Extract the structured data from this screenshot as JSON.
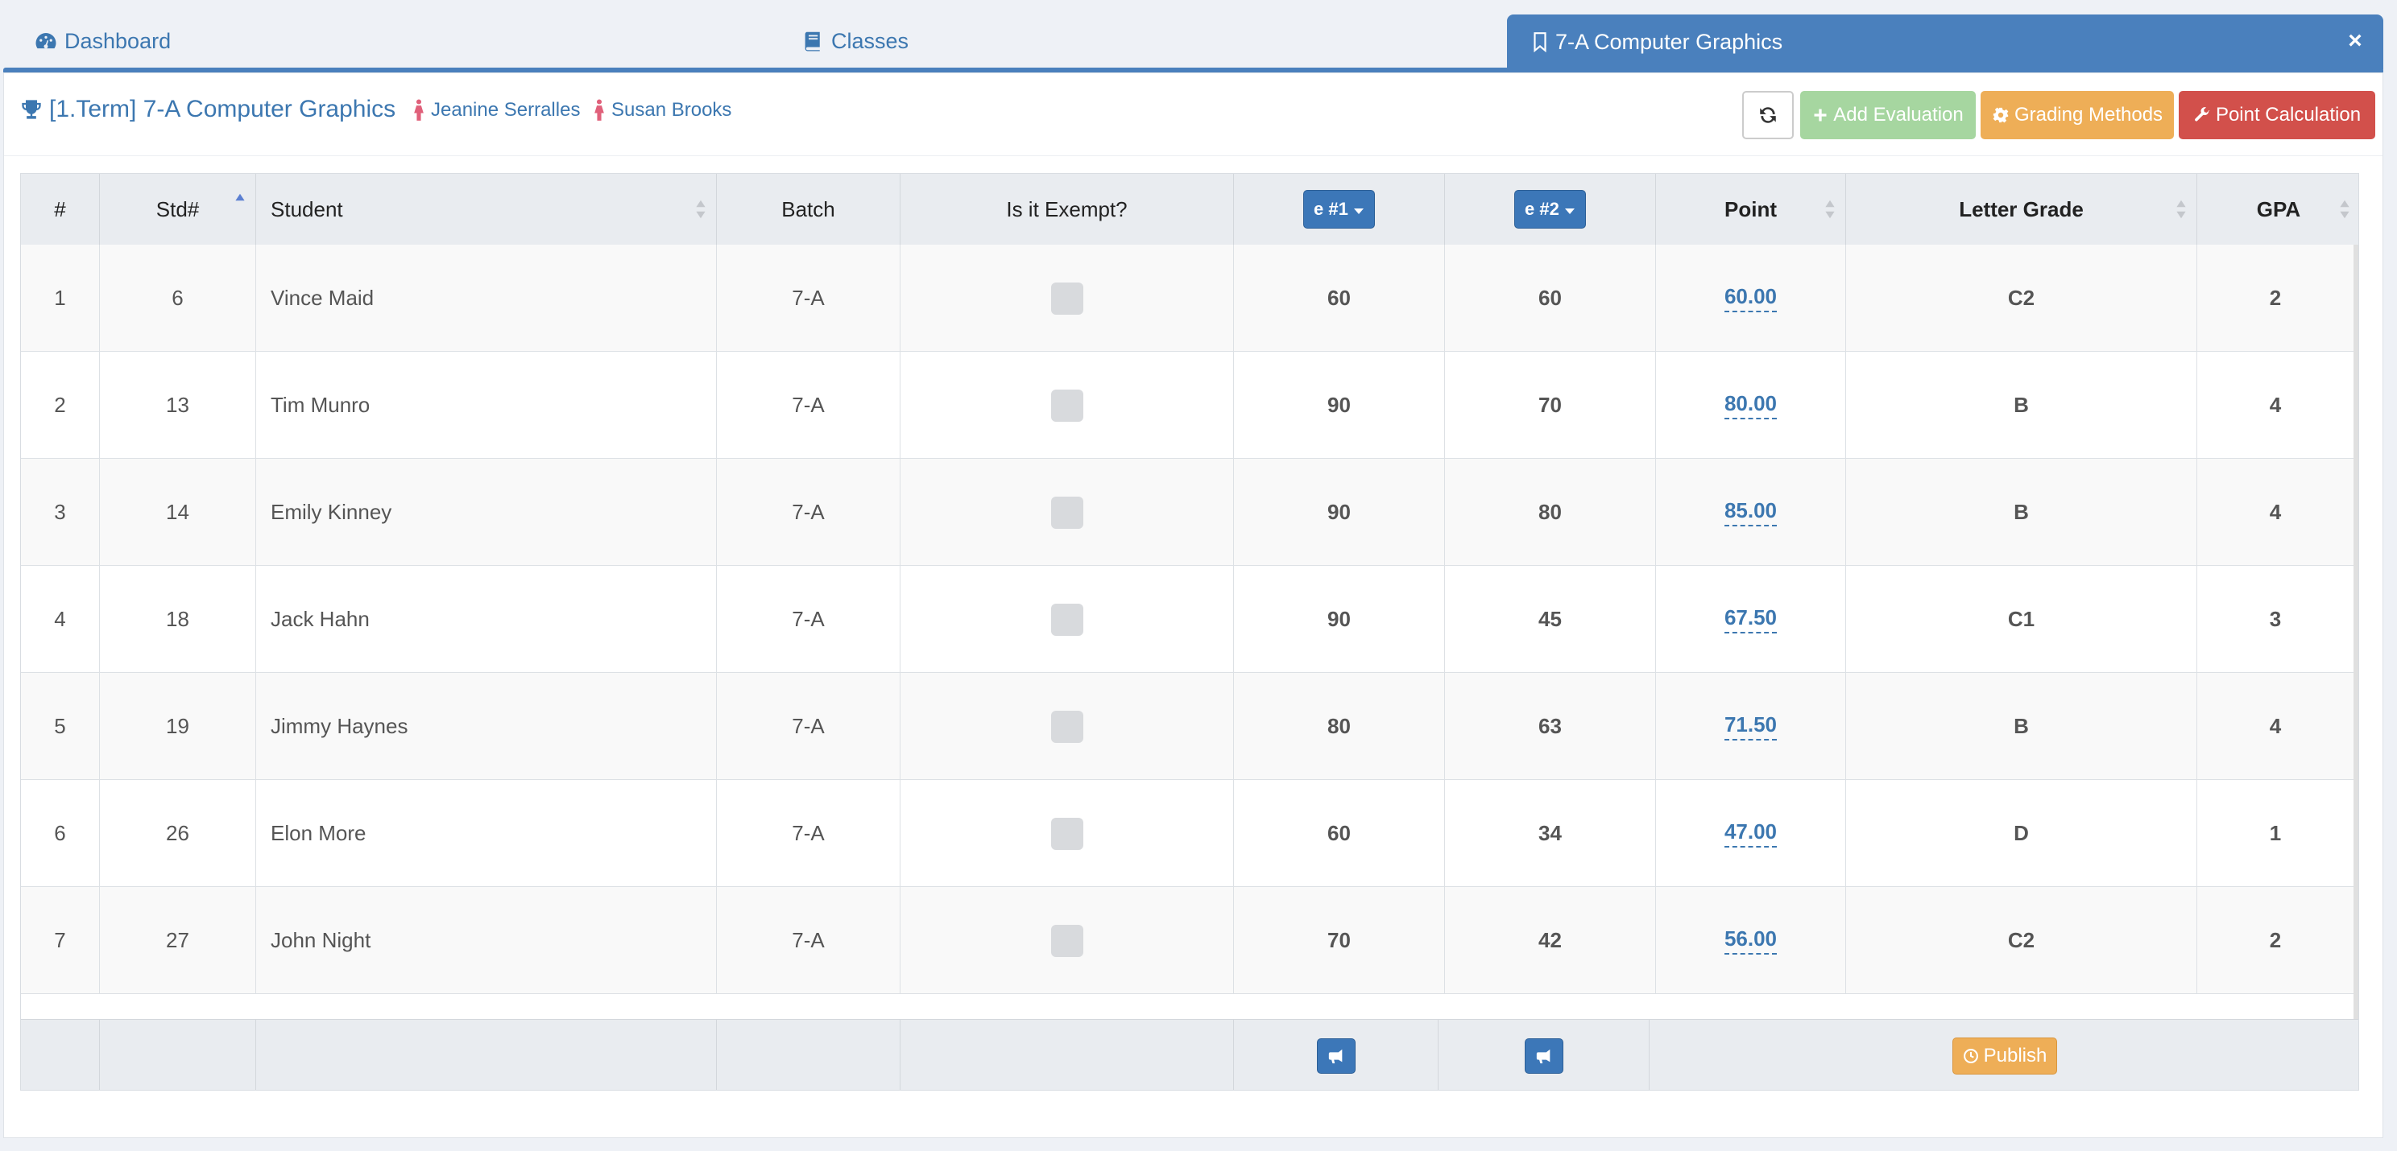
{
  "tabs": {
    "dashboard": "Dashboard",
    "classes": "Classes",
    "active": "7-A Computer Graphics",
    "close": "×"
  },
  "header": {
    "class_title": "[1.Term] 7-A Computer Graphics",
    "teachers": [
      "Jeanine Serralles",
      "Susan Brooks"
    ]
  },
  "toolbar": {
    "add_evaluation": "Add Evaluation",
    "grading_methods": "Grading Methods",
    "point_calculation": "Point Calculation"
  },
  "table": {
    "columns": {
      "num": "#",
      "std": "Std#",
      "student": "Student",
      "batch": "Batch",
      "exempt": "Is it Exempt?",
      "e1": "e #1",
      "e2": "e #2",
      "point": "Point",
      "letter": "Letter Grade",
      "gpa": "GPA"
    },
    "rows": [
      {
        "num": "1",
        "std": "6",
        "student": "Vince Maid",
        "batch": "7-A",
        "e1": "60",
        "e2": "60",
        "point": "60.00",
        "letter": "C2",
        "gpa": "2"
      },
      {
        "num": "2",
        "std": "13",
        "student": "Tim Munro",
        "batch": "7-A",
        "e1": "90",
        "e2": "70",
        "point": "80.00",
        "letter": "B",
        "gpa": "4"
      },
      {
        "num": "3",
        "std": "14",
        "student": "Emily Kinney",
        "batch": "7-A",
        "e1": "90",
        "e2": "80",
        "point": "85.00",
        "letter": "B",
        "gpa": "4"
      },
      {
        "num": "4",
        "std": "18",
        "student": "Jack Hahn",
        "batch": "7-A",
        "e1": "90",
        "e2": "45",
        "point": "67.50",
        "letter": "C1",
        "gpa": "3"
      },
      {
        "num": "5",
        "std": "19",
        "student": "Jimmy Haynes",
        "batch": "7-A",
        "e1": "80",
        "e2": "63",
        "point": "71.50",
        "letter": "B",
        "gpa": "4"
      },
      {
        "num": "6",
        "std": "26",
        "student": "Elon More",
        "batch": "7-A",
        "e1": "60",
        "e2": "34",
        "point": "47.00",
        "letter": "D",
        "gpa": "1"
      },
      {
        "num": "7",
        "std": "27",
        "student": "John Night",
        "batch": "7-A",
        "e1": "70",
        "e2": "42",
        "point": "56.00",
        "letter": "C2",
        "gpa": "2"
      }
    ]
  },
  "footer": {
    "publish": "Publish"
  },
  "colors": {
    "primary": "#4a80bd",
    "success_light": "#a6d6a0",
    "warning": "#eeae57",
    "danger": "#d2504b"
  }
}
